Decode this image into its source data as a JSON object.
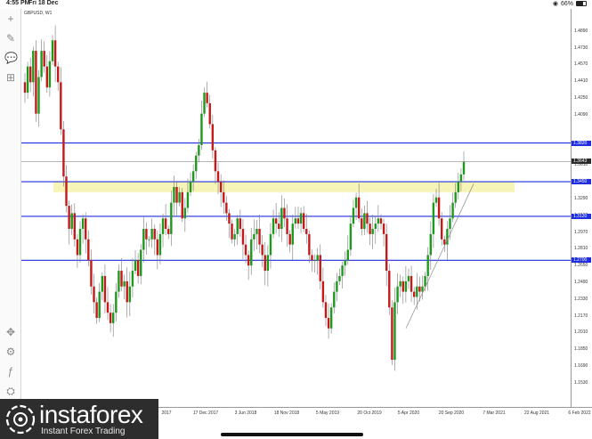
{
  "status": {
    "time": "4:55 PM",
    "date": "Fri 18 Dec",
    "battery": "66%",
    "battery_level": 0.66
  },
  "toolbar": {
    "tools": [
      {
        "name": "crosshair-icon",
        "glyph": "+"
      },
      {
        "name": "pencil-icon",
        "glyph": "✎"
      },
      {
        "name": "comment-icon",
        "glyph": "💬"
      },
      {
        "name": "add-indicator-icon",
        "glyph": "⊞"
      },
      {
        "name": "move-icon",
        "glyph": "✥"
      },
      {
        "name": "settings-icon",
        "glyph": "⚙"
      },
      {
        "name": "fx-icon",
        "glyph": "ƒ"
      },
      {
        "name": "objects-icon",
        "glyph": "⛭"
      }
    ]
  },
  "symbol_label": "GBPUSD, W1",
  "watermark": {
    "brand": "instaforex",
    "tagline": "Instant Forex Trading"
  },
  "chart_data": {
    "type": "candlestick",
    "symbol": "GBPUSD",
    "timeframe": "W1",
    "price_axis": {
      "min": 1.13,
      "max": 1.51,
      "ticks": [
        "1.4890",
        "1.4730",
        "1.4570",
        "1.4410",
        "1.4250",
        "1.4090",
        "1.3610",
        "1.3450",
        "1.3290",
        "1.3130",
        "1.2970",
        "1.2810",
        "1.2650",
        "1.2490",
        "1.2330",
        "1.2170",
        "1.2010",
        "1.1850",
        "1.1690",
        "1.1530"
      ]
    },
    "date_axis": {
      "labels": [
        "2017",
        "17 Dec 2017",
        "3 Jun 2018",
        "18 Nov 2018",
        "5 May 2019",
        "20 Oct 2019",
        "5 Apr 2020",
        "20 Sep 2020",
        "7 Mar 2021",
        "22 Aug 2021",
        "6 Feb 2022"
      ]
    },
    "horizontal_levels": [
      {
        "price": 1.382,
        "label": "1.3820",
        "color": "#1f2fe0"
      },
      {
        "price": 1.3643,
        "label": "1.3643",
        "color": "#8c8c8c",
        "current": true
      },
      {
        "price": 1.345,
        "label": "1.3450",
        "color": "#1f2fe0"
      },
      {
        "price": 1.312,
        "label": "1.3120",
        "color": "#1f2fe0"
      },
      {
        "price": 1.27,
        "label": "1.2700",
        "color": "#1f2fe0"
      }
    ],
    "zone": {
      "from": 1.335,
      "to": 1.3455,
      "color": "#f7f4b8"
    },
    "trendline": {
      "from": [
        1.205
      ],
      "to": [
        1.343
      ],
      "color": "#8a8a8a"
    },
    "colors": {
      "bull": "#1d9a1d",
      "bear": "#c41a1a",
      "wick": "#7a7a7a",
      "level": "#1f2fe0",
      "zone": "#f7f4b8"
    },
    "closes": [
      1.43,
      1.455,
      1.44,
      1.47,
      1.41,
      1.445,
      1.47,
      1.455,
      1.435,
      1.46,
      1.48,
      1.455,
      1.44,
      1.395,
      1.35,
      1.322,
      1.3,
      1.315,
      1.29,
      1.275,
      1.3,
      1.31,
      1.29,
      1.27,
      1.245,
      1.23,
      1.215,
      1.24,
      1.255,
      1.23,
      1.22,
      1.21,
      1.22,
      1.24,
      1.26,
      1.245,
      1.25,
      1.23,
      1.245,
      1.26,
      1.27,
      1.255,
      1.28,
      1.3,
      1.29,
      1.29,
      1.3,
      1.29,
      1.275,
      1.295,
      1.31,
      1.3,
      1.295,
      1.325,
      1.34,
      1.325,
      1.335,
      1.31,
      1.32,
      1.335,
      1.345,
      1.355,
      1.37,
      1.38,
      1.41,
      1.43,
      1.42,
      1.4,
      1.375,
      1.355,
      1.345,
      1.335,
      1.325,
      1.315,
      1.305,
      1.29,
      1.295,
      1.31,
      1.3,
      1.285,
      1.275,
      1.265,
      1.29,
      1.295,
      1.3,
      1.285,
      1.275,
      1.26,
      1.275,
      1.295,
      1.31,
      1.305,
      1.3,
      1.32,
      1.31,
      1.295,
      1.285,
      1.305,
      1.31,
      1.305,
      1.315,
      1.3,
      1.295,
      1.275,
      1.27,
      1.27,
      1.275,
      1.25,
      1.23,
      1.215,
      1.205,
      1.225,
      1.24,
      1.25,
      1.255,
      1.265,
      1.27,
      1.28,
      1.305,
      1.32,
      1.33,
      1.31,
      1.3,
      1.315,
      1.305,
      1.295,
      1.3,
      1.305,
      1.31,
      1.305,
      1.295,
      1.26,
      1.225,
      1.175,
      1.23,
      1.245,
      1.25,
      1.24,
      1.25,
      1.255,
      1.24,
      1.235,
      1.245,
      1.24,
      1.245,
      1.255,
      1.275,
      1.295,
      1.325,
      1.33,
      1.31,
      1.29,
      1.285,
      1.3,
      1.31,
      1.325,
      1.335,
      1.345,
      1.352,
      1.364
    ]
  }
}
